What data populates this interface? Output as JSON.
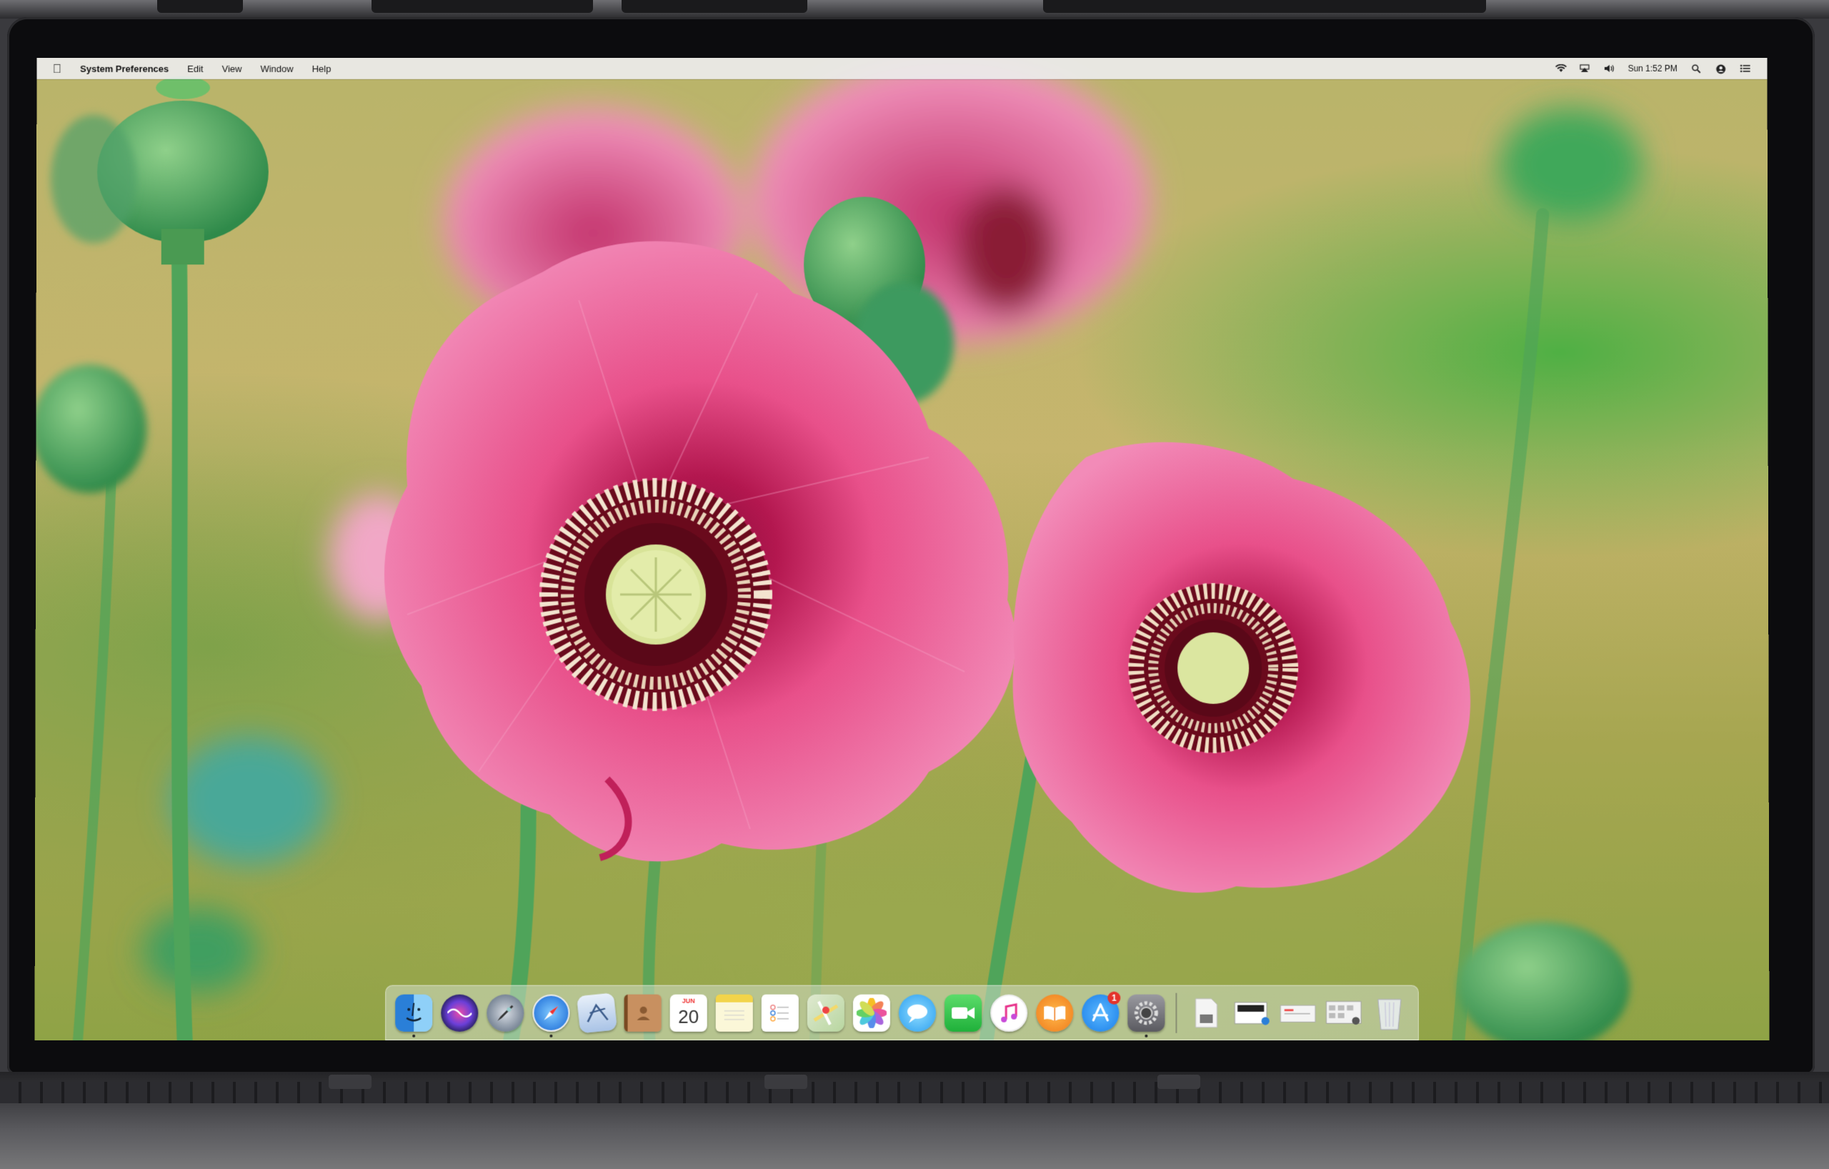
{
  "menubar": {
    "app_name": "System Preferences",
    "menus": [
      "Edit",
      "View",
      "Window",
      "Help"
    ],
    "clock": "Sun 1:52 PM"
  },
  "dock": {
    "apps": [
      {
        "icon": "finder-icon",
        "color": "#3b8fe0",
        "running": true
      },
      {
        "icon": "siri-icon",
        "color": "#4b3fa8",
        "running": false
      },
      {
        "icon": "launchpad-icon",
        "color": "#6c7a8c",
        "running": false
      },
      {
        "icon": "safari-icon",
        "color": "#2d8ef0",
        "running": true
      },
      {
        "icon": "mail-icon",
        "color": "#c9d9ef",
        "running": false
      },
      {
        "icon": "contacts-icon",
        "color": "#b07a48",
        "running": false
      },
      {
        "icon": "calendar-icon",
        "color": "#ffffff",
        "running": false,
        "month": "JUN",
        "day": "20"
      },
      {
        "icon": "notes-icon",
        "color": "#f5e27a",
        "running": false
      },
      {
        "icon": "reminders-icon",
        "color": "#ffffff",
        "running": false
      },
      {
        "icon": "maps-icon",
        "color": "#d8e6c6",
        "running": false
      },
      {
        "icon": "photos-icon",
        "color": "#ffffff",
        "running": false
      },
      {
        "icon": "messages-icon",
        "color": "#3fb3f5",
        "running": false
      },
      {
        "icon": "facetime-icon",
        "color": "#2fc24a",
        "running": false
      },
      {
        "icon": "itunes-icon",
        "color": "#ffffff",
        "running": false
      },
      {
        "icon": "ibooks-icon",
        "color": "#f08a24",
        "running": false
      },
      {
        "icon": "app-store-icon",
        "color": "#1a8cf0",
        "running": false,
        "badge": "1"
      },
      {
        "icon": "system-preferences-icon",
        "color": "#7a7a7e",
        "running": true
      }
    ],
    "stacks": [
      {
        "icon": "document-stack-icon",
        "color": "#e8e8e8"
      },
      {
        "icon": "screenshot-stack-icon",
        "color": "#f0f0f0"
      },
      {
        "icon": "folder-stack-icon",
        "color": "#f4f4f4"
      },
      {
        "icon": "downloads-stack-icon",
        "color": "#eeeeee"
      },
      {
        "icon": "trash-icon",
        "color": "#e0e4e8"
      }
    ]
  }
}
